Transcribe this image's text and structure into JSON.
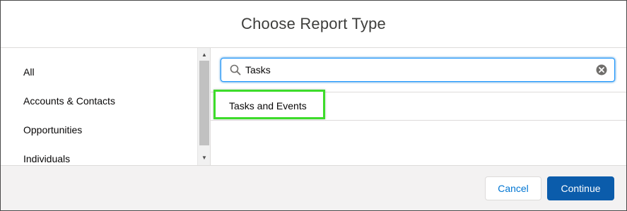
{
  "modal": {
    "title": "Choose Report Type"
  },
  "sidebar": {
    "items": [
      {
        "label": "All"
      },
      {
        "label": "Accounts & Contacts"
      },
      {
        "label": "Opportunities"
      },
      {
        "label": "Individuals"
      }
    ]
  },
  "search": {
    "value": "Tasks",
    "icon": "search-icon",
    "clear_icon": "clear-icon"
  },
  "results": [
    {
      "label": "Tasks and Events",
      "highlighted": true
    }
  ],
  "footer": {
    "cancel_label": "Cancel",
    "continue_label": "Continue"
  },
  "colors": {
    "highlight": "#3ddc2a",
    "primary_button": "#0b5cab",
    "link": "#0176d3",
    "focus_border": "#1b96ff"
  }
}
